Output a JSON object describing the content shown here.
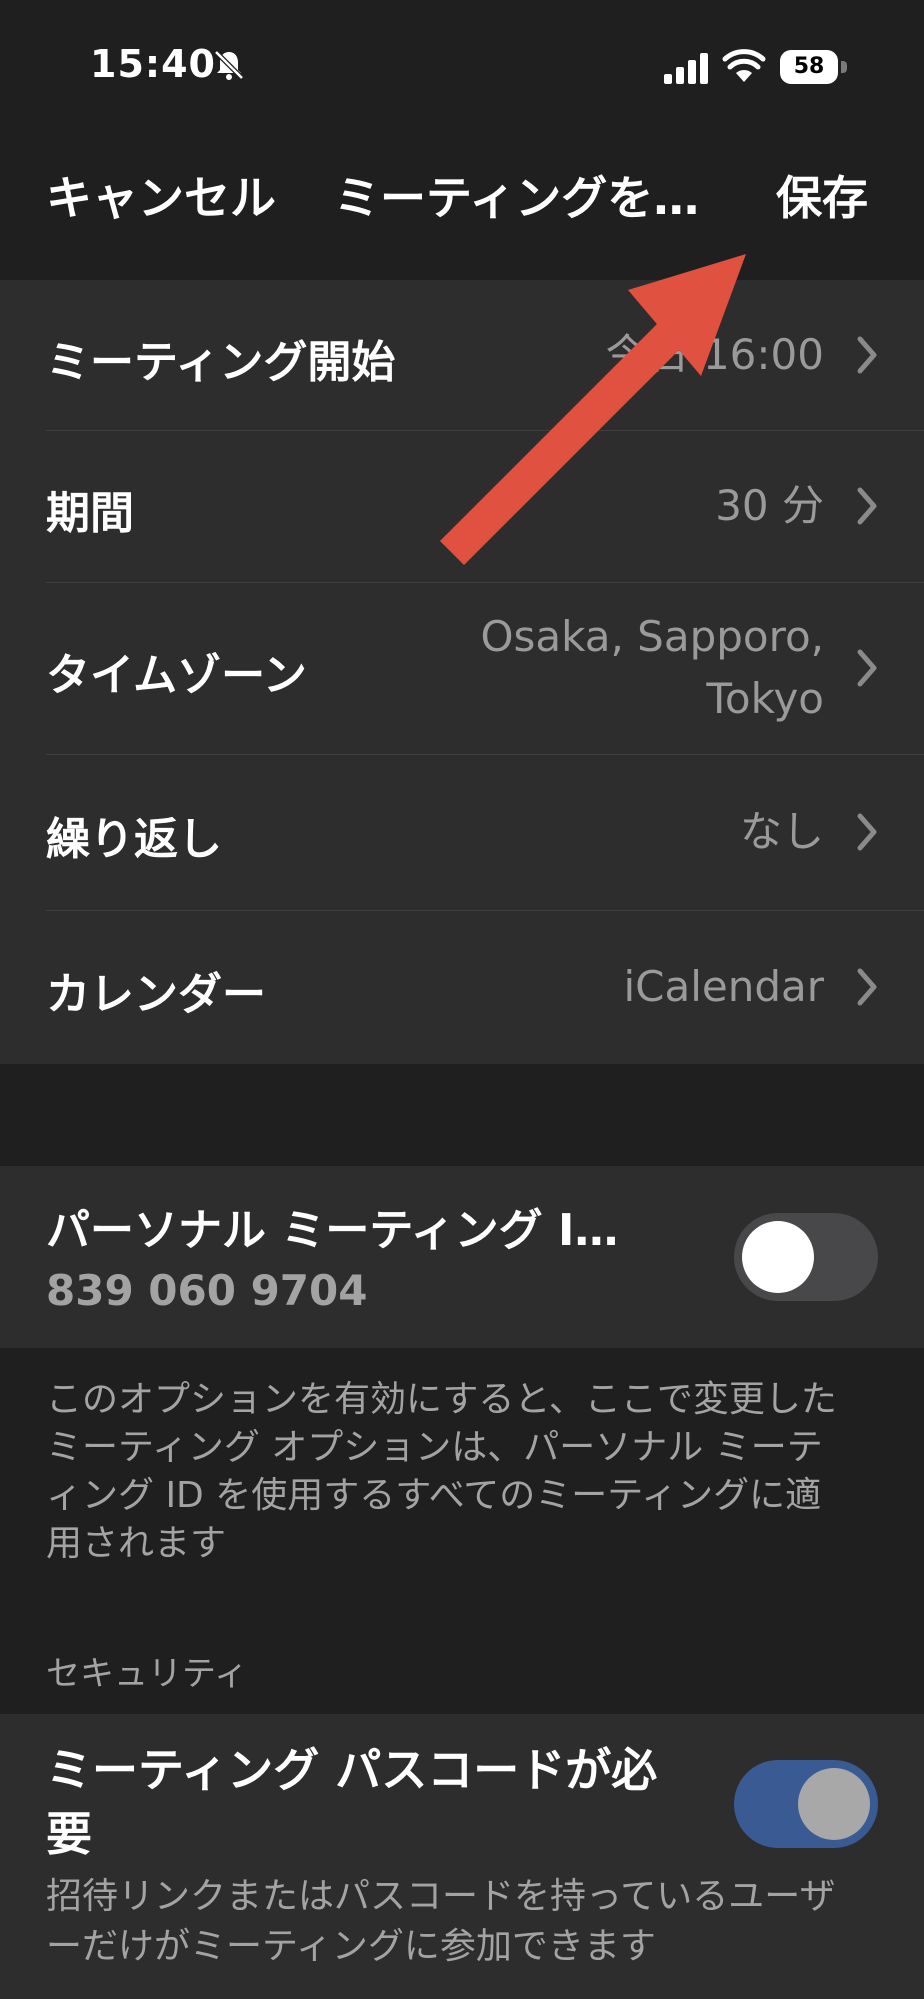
{
  "status_bar": {
    "time": "15:40",
    "battery": "58"
  },
  "nav": {
    "cancel": "キャンセル",
    "title": "ミーティングを…",
    "save": "保存"
  },
  "settings": [
    {
      "label": "ミーティング開始",
      "value": "今日 16:00"
    },
    {
      "label": "期間",
      "value": "30 分"
    },
    {
      "label": "タイムゾーン",
      "value_line1": "Osaka, Sapporo,",
      "value_line2": "Tokyo"
    },
    {
      "label": "繰り返し",
      "value": "なし"
    },
    {
      "label": "カレンダー",
      "value": "iCalendar"
    }
  ],
  "pmi": {
    "label": "パーソナル ミーティング I…",
    "id": "839 060 9704",
    "enabled": false
  },
  "pmi_note": "このオプションを有効にすると、ここで変更したミーティング オプションは、パーソナル ミーティング ID を使用するすべてのミーティングに適用されます",
  "security": {
    "header": "セキュリティ",
    "passcode_label": "ミーティング パスコードが必要",
    "passcode_enabled": true,
    "passcode_desc": "招待リンクまたはパスコードを持っているユーザーだけがミーティングに参加できます"
  },
  "colors": {
    "background": "#1f1f1f",
    "group": "#2d2d2d",
    "toggle_on": "#3a5a94",
    "toggle_off": "#48484a",
    "annotation_arrow": "#e0523f"
  }
}
